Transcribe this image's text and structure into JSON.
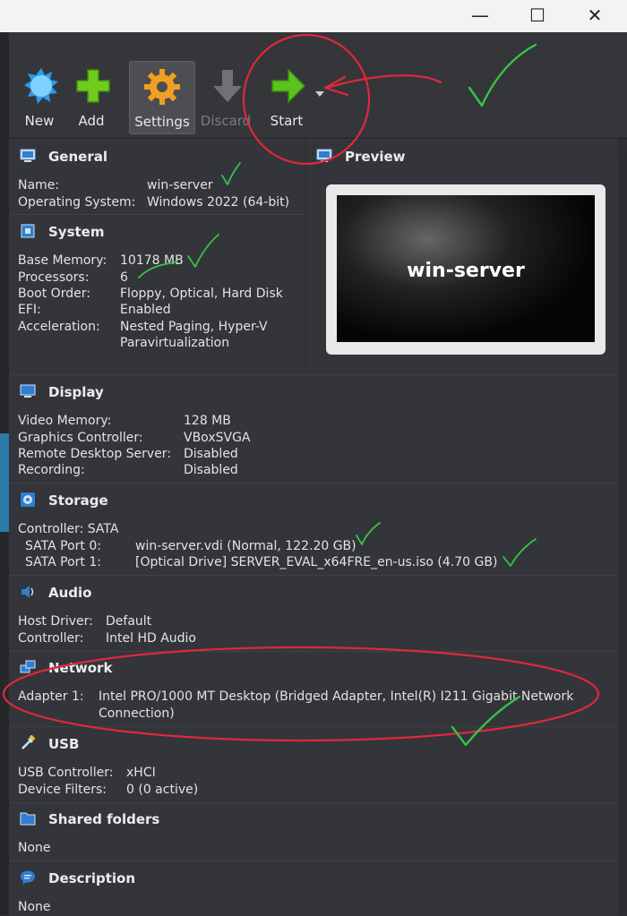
{
  "window": {
    "minimize": "—",
    "maximize": "☐",
    "close": "✕"
  },
  "toolbar": {
    "new": "New",
    "add": "Add",
    "settings": "Settings",
    "discard": "Discard",
    "start": "Start"
  },
  "general": {
    "title": "General",
    "name_k": "Name:",
    "name_v": "win-server",
    "os_k": "Operating System:",
    "os_v": "Windows 2022 (64-bit)"
  },
  "preview": {
    "title": "Preview",
    "screen_text": "win-server"
  },
  "system": {
    "title": "System",
    "mem_k": "Base Memory:",
    "mem_v": "10178 MB",
    "proc_k": "Processors:",
    "proc_v": "6",
    "boot_k": "Boot Order:",
    "boot_v": "Floppy, Optical, Hard Disk",
    "efi_k": "EFI:",
    "efi_v": "Enabled",
    "acc_k": "Acceleration:",
    "acc_v1": "Nested Paging, Hyper-V",
    "acc_v2": "Paravirtualization"
  },
  "display": {
    "title": "Display",
    "vm_k": "Video Memory:",
    "vm_v": "128 MB",
    "gc_k": "Graphics Controller:",
    "gc_v": "VBoxSVGA",
    "rds_k": "Remote Desktop Server:",
    "rds_v": "Disabled",
    "rec_k": "Recording:",
    "rec_v": "Disabled"
  },
  "storage": {
    "title": "Storage",
    "ctrl": "Controller: SATA",
    "p0_k": "SATA Port 0:",
    "p0_v": "win-server.vdi (Normal, 122.20 GB)",
    "p1_k": "SATA Port 1:",
    "p1_v": "[Optical Drive] SERVER_EVAL_x64FRE_en-us.iso (4.70 GB)"
  },
  "audio": {
    "title": "Audio",
    "hd_k": "Host Driver:",
    "hd_v": "Default",
    "c_k": "Controller:",
    "c_v": "Intel HD Audio"
  },
  "network": {
    "title": "Network",
    "a1_k": "Adapter 1:",
    "a1_v1": "Intel PRO/1000 MT Desktop (Bridged Adapter, Intel(R) I211 Gigabit Network",
    "a1_v2": "Connection)"
  },
  "usb": {
    "title": "USB",
    "uc_k": "USB Controller:",
    "uc_v": "xHCI",
    "df_k": "Device Filters:",
    "df_v": "0 (0 active)"
  },
  "shared": {
    "title": "Shared folders",
    "value": "None"
  },
  "description": {
    "title": "Description",
    "value": "None"
  },
  "colors": {
    "annotation_red": "#e0283a",
    "annotation_green": "#35c447",
    "start_green": "#5cc21e",
    "accent_blue": "#2c7aa8"
  }
}
